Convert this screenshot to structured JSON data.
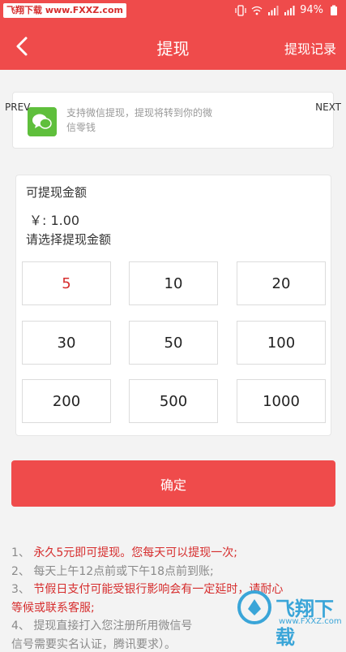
{
  "status_bar": {
    "watermark": "飞翔下载 www.FXXZ.com",
    "battery": "94%",
    "icons": [
      "vibrate-icon",
      "wifi-icon",
      "signal-icon",
      "signal-icon",
      "battery-icon"
    ]
  },
  "header": {
    "title": "提现",
    "record_label": "提现记录",
    "back_icon": "back-arrow-icon"
  },
  "carousel": {
    "prev_label": "PREV",
    "next_label": "NEXT",
    "wechat_text": "支持微信提现，提现将转到你的微信零钱",
    "icon": "wechat-icon"
  },
  "withdraw": {
    "label_available": "可提现金额",
    "amount": "￥: 1.00",
    "label_choose": "请选择提现金额",
    "options": [
      "5",
      "10",
      "20",
      "30",
      "50",
      "100",
      "200",
      "500",
      "1000"
    ],
    "selected": "5"
  },
  "confirm_label": "确定",
  "notes": {
    "n1_prefix": "1、",
    "n1": " 永久5元即可提现。您每天可以提现一次;",
    "n2": "2、 每天上午12点前或下午18点前到账;",
    "n3_prefix": "3、",
    "n3a": " 节假日支付可能受银行影响会有一定延时，请耐心",
    "n3b": "等候或联系客服;",
    "n4a": "4、 提现直接打入您注册所用微信号",
    "n4b": "信号需要实名认证，腾讯要求）。"
  },
  "watermark2": {
    "text": "飞翔下载",
    "sub": "www.FXXZ.com"
  },
  "colors": {
    "accent": "#ef4b4b",
    "highlight": "#d62d2d",
    "wechat": "#5fbf3c"
  }
}
